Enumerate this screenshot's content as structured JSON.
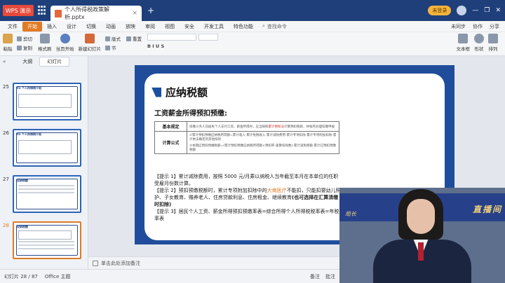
{
  "titlebar": {
    "app_label": "WPS 演示",
    "doc_tab": "个人所得税政策解析.pptx",
    "login": "未登录"
  },
  "menubar": {
    "items": [
      "文件",
      "开始",
      "插入",
      "设计",
      "切换",
      "动画",
      "放映",
      "审阅",
      "视图",
      "安全",
      "开发工具",
      "特色功能"
    ],
    "active": "开始",
    "search": "查找命令",
    "right": [
      "未同步",
      "协作",
      "分享"
    ]
  },
  "ribbon": {
    "groups": [
      "粘贴",
      "新建幻灯片",
      "版式",
      "节",
      "重置",
      "文本框",
      "形状",
      "排列"
    ],
    "small": [
      "剪切",
      "复制",
      "格式刷",
      "当页开始"
    ],
    "font_sample": "B I U S"
  },
  "panel": {
    "tabs": [
      "大纲",
      "幻灯片"
    ],
    "active_tab": "幻灯片",
    "thumbs": [
      {
        "num": "25",
        "title": "01 个人所得税介绍"
      },
      {
        "num": "26",
        "title": "01 个人所得税介绍"
      },
      {
        "num": "27",
        "title": "应纳税额"
      },
      {
        "num": "28",
        "title": "应纳税额"
      }
    ]
  },
  "slide": {
    "title": "应纳税额",
    "subtitle": "工资薪金所得预扣预缴:",
    "table": [
      {
        "head": "基本规定",
        "text_a": "扣缴义务人向居民个人支付工资、薪金所得时，应当按照",
        "text_red": "累计预扣法",
        "text_b": "计算预扣税款，并按月办理扣缴申报"
      },
      {
        "head": "计算公式",
        "lines": [
          "①累计预扣预缴应纳税所得额=累计收入-累计免税收入-累计减除费用-累计专项扣除-累计专项附加扣除-累计依法确定的其他扣除",
          "②本期应预扣预缴税额=(累计预扣预缴应纳税所得额×预扣率-速算扣除数)-累计减免税额-累计已预扣预缴税额"
        ]
      }
    ],
    "note1": "【提示 1】累计减除费用，按照 5000 元/月乘以纳税人当年截至本月在本单位的任职受雇月份数计算。",
    "note2_a": "【提示 2】预扣预缴税额时，累计专项附加扣除中的",
    "note2_orange": "大病医疗",
    "note2_b": "不能扣，只能扣婴幼儿照护、子女教育、赡养老人、住房贷款利息、住房租金、继续教育",
    "note2_bold": "(也可选择在汇算清缴时扣除)",
    "note3": "【提示 3】居民个人工资、薪金所得预扣预缴率表=综合所得个人所得税税率表=年税率表"
  },
  "video": {
    "banner_right": "直播间",
    "banner_left": "局长"
  },
  "notes_placeholder": "单击此处添加备注",
  "status": {
    "slide_count": "幻灯片 28 / 87",
    "theme": "Office 主题",
    "notes_btn": "备注",
    "comment_btn": "批注"
  }
}
